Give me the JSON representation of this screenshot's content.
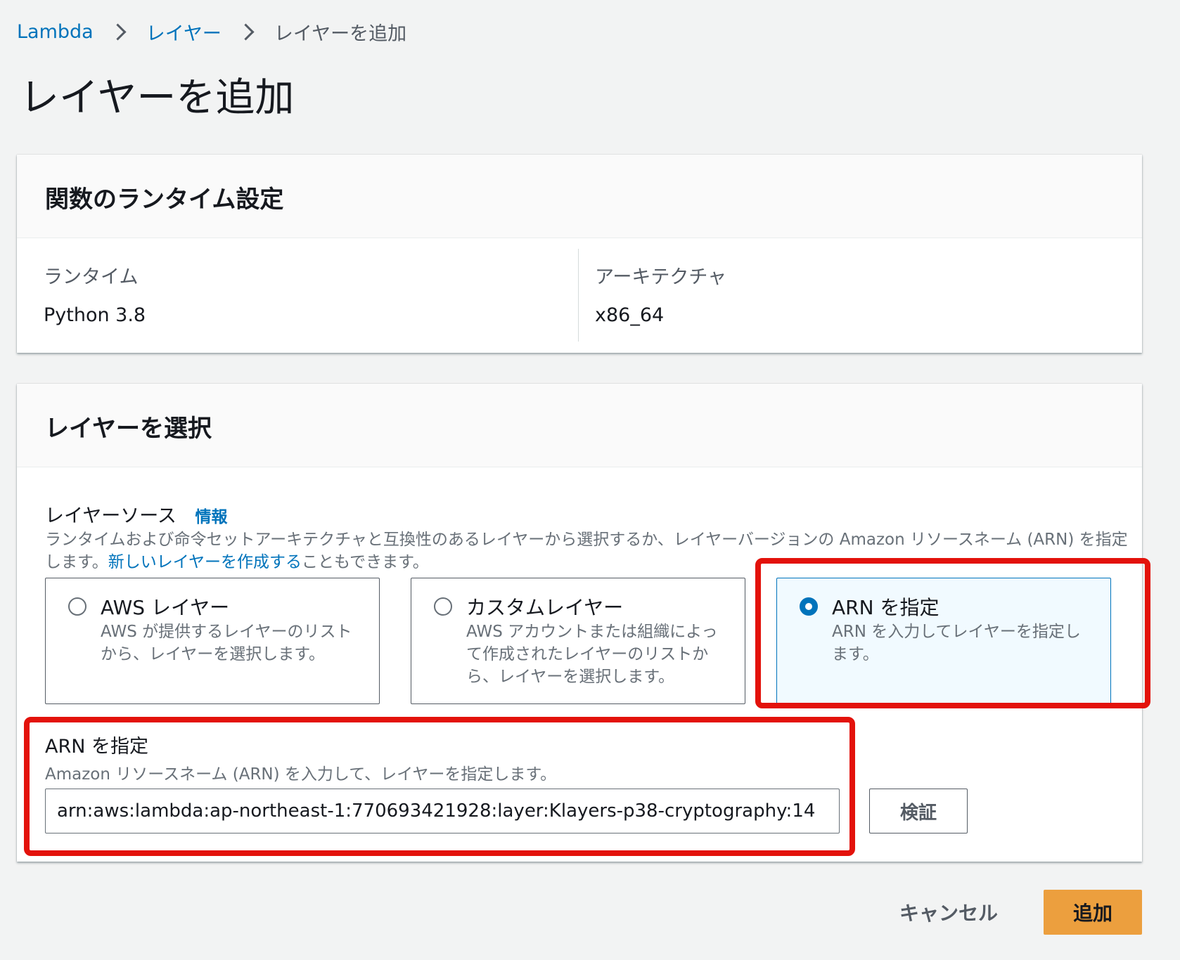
{
  "breadcrumb": {
    "items": [
      {
        "label": "Lambda"
      },
      {
        "label": "レイヤー"
      },
      {
        "label": "レイヤーを追加"
      }
    ]
  },
  "page": {
    "title": "レイヤーを追加"
  },
  "runtime_card": {
    "title": "関数のランタイム設定",
    "runtime_label": "ランタイム",
    "runtime_value": "Python 3.8",
    "arch_label": "アーキテクチャ",
    "arch_value": "x86_64"
  },
  "layer_card": {
    "title": "レイヤーを選択",
    "source_label": "レイヤーソース",
    "info_link": "情報",
    "desc_prefix": "ランタイムおよび命令セットアーキテクチャと互換性のあるレイヤーから選択するか、レイヤーバージョンの Amazon リソースネーム (ARN) を指定します。",
    "desc_link": "新しいレイヤーを作成する",
    "desc_suffix": "こともできます。",
    "options": [
      {
        "title": "AWS レイヤー",
        "desc": "AWS が提供するレイヤーのリストから、レイヤーを選択します。",
        "selected": false
      },
      {
        "title": "カスタムレイヤー",
        "desc": "AWS アカウントまたは組織によって作成されたレイヤーのリストから、レイヤーを選択します。",
        "selected": false
      },
      {
        "title": "ARN を指定",
        "desc": "ARN を入力してレイヤーを指定します。",
        "selected": true
      }
    ],
    "arn_label": "ARN を指定",
    "arn_desc": "Amazon リソースネーム (ARN) を入力して、レイヤーを指定します。",
    "arn_value": "arn:aws:lambda:ap-northeast-1:770693421928:layer:Klayers-p38-cryptography:14",
    "verify_button": "検証"
  },
  "footer": {
    "cancel_button": "キャンセル",
    "add_button": "追加"
  },
  "colors": {
    "link": "#0073bb",
    "primary_button": "#ec9f3e",
    "highlight": "#e3120b",
    "page_bg": "#f2f3f3"
  }
}
